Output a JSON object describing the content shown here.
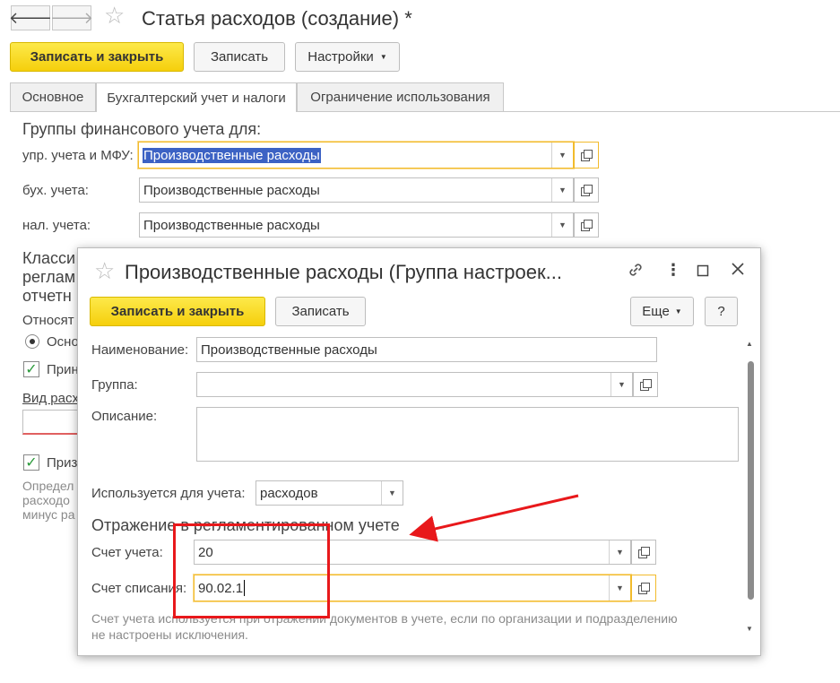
{
  "window": {
    "title": "Статья расходов (создание) *",
    "back_label": "🡐",
    "forward_label": "🡒",
    "star": "☆"
  },
  "toolbar": {
    "save_close_label": "Записать и закрыть",
    "save_label": "Записать",
    "settings_label": "Настройки"
  },
  "tabs": [
    {
      "label": "Основное"
    },
    {
      "label": "Бухгалтерский учет и налоги"
    },
    {
      "label": "Ограничение использования"
    }
  ],
  "fin_groups": {
    "heading": "Группы финансового учета для:",
    "rows": [
      {
        "label": "упр. учета и МФУ:",
        "value": "Производственные расходы"
      },
      {
        "label": "бух. учета:",
        "value": "Производственные расходы"
      },
      {
        "label": "нал. учета:",
        "value": "Производственные расходы"
      }
    ]
  },
  "background_fragments": {
    "classif_line1": "Класси",
    "classif_line2": "реглам",
    "classif_line3": "отчетн",
    "relates_label": "Относят",
    "radio_label": "Осно",
    "check1_label": "Прин",
    "vid_label": "Вид расх",
    "check2_label": "Приз",
    "desc_line1": "Определ",
    "desc_line2": "расходо",
    "desc_line3": "минус ра"
  },
  "dialog": {
    "title": "Производственные расходы (Группа настроек...",
    "save_close_label": "Записать и закрыть",
    "save_label": "Записать",
    "more_label": "Еще",
    "help_label": "?",
    "name_label": "Наименование:",
    "name_value": "Производственные расходы",
    "group_label": "Группа:",
    "group_value": "",
    "desc_label": "Описание:",
    "desc_value": "",
    "used_for_label": "Используется для учета:",
    "used_for_value": "расходов",
    "reg_heading": "Отражение в регламентированном учете",
    "account_label": "Счет учета:",
    "account_value": "20",
    "writeoff_label": "Счет списания:",
    "writeoff_value": "90.02.1",
    "hint_line1": "Счет учета используется при отражении документов в учете, если по организации и подразделению",
    "hint_line2": "не настроены исключения."
  },
  "colors": {
    "accent_green": "#2a9a3a",
    "yellow_button": "#f5d31a",
    "focus_border": "#f2bb2c",
    "annotation_red": "#e8181b"
  }
}
